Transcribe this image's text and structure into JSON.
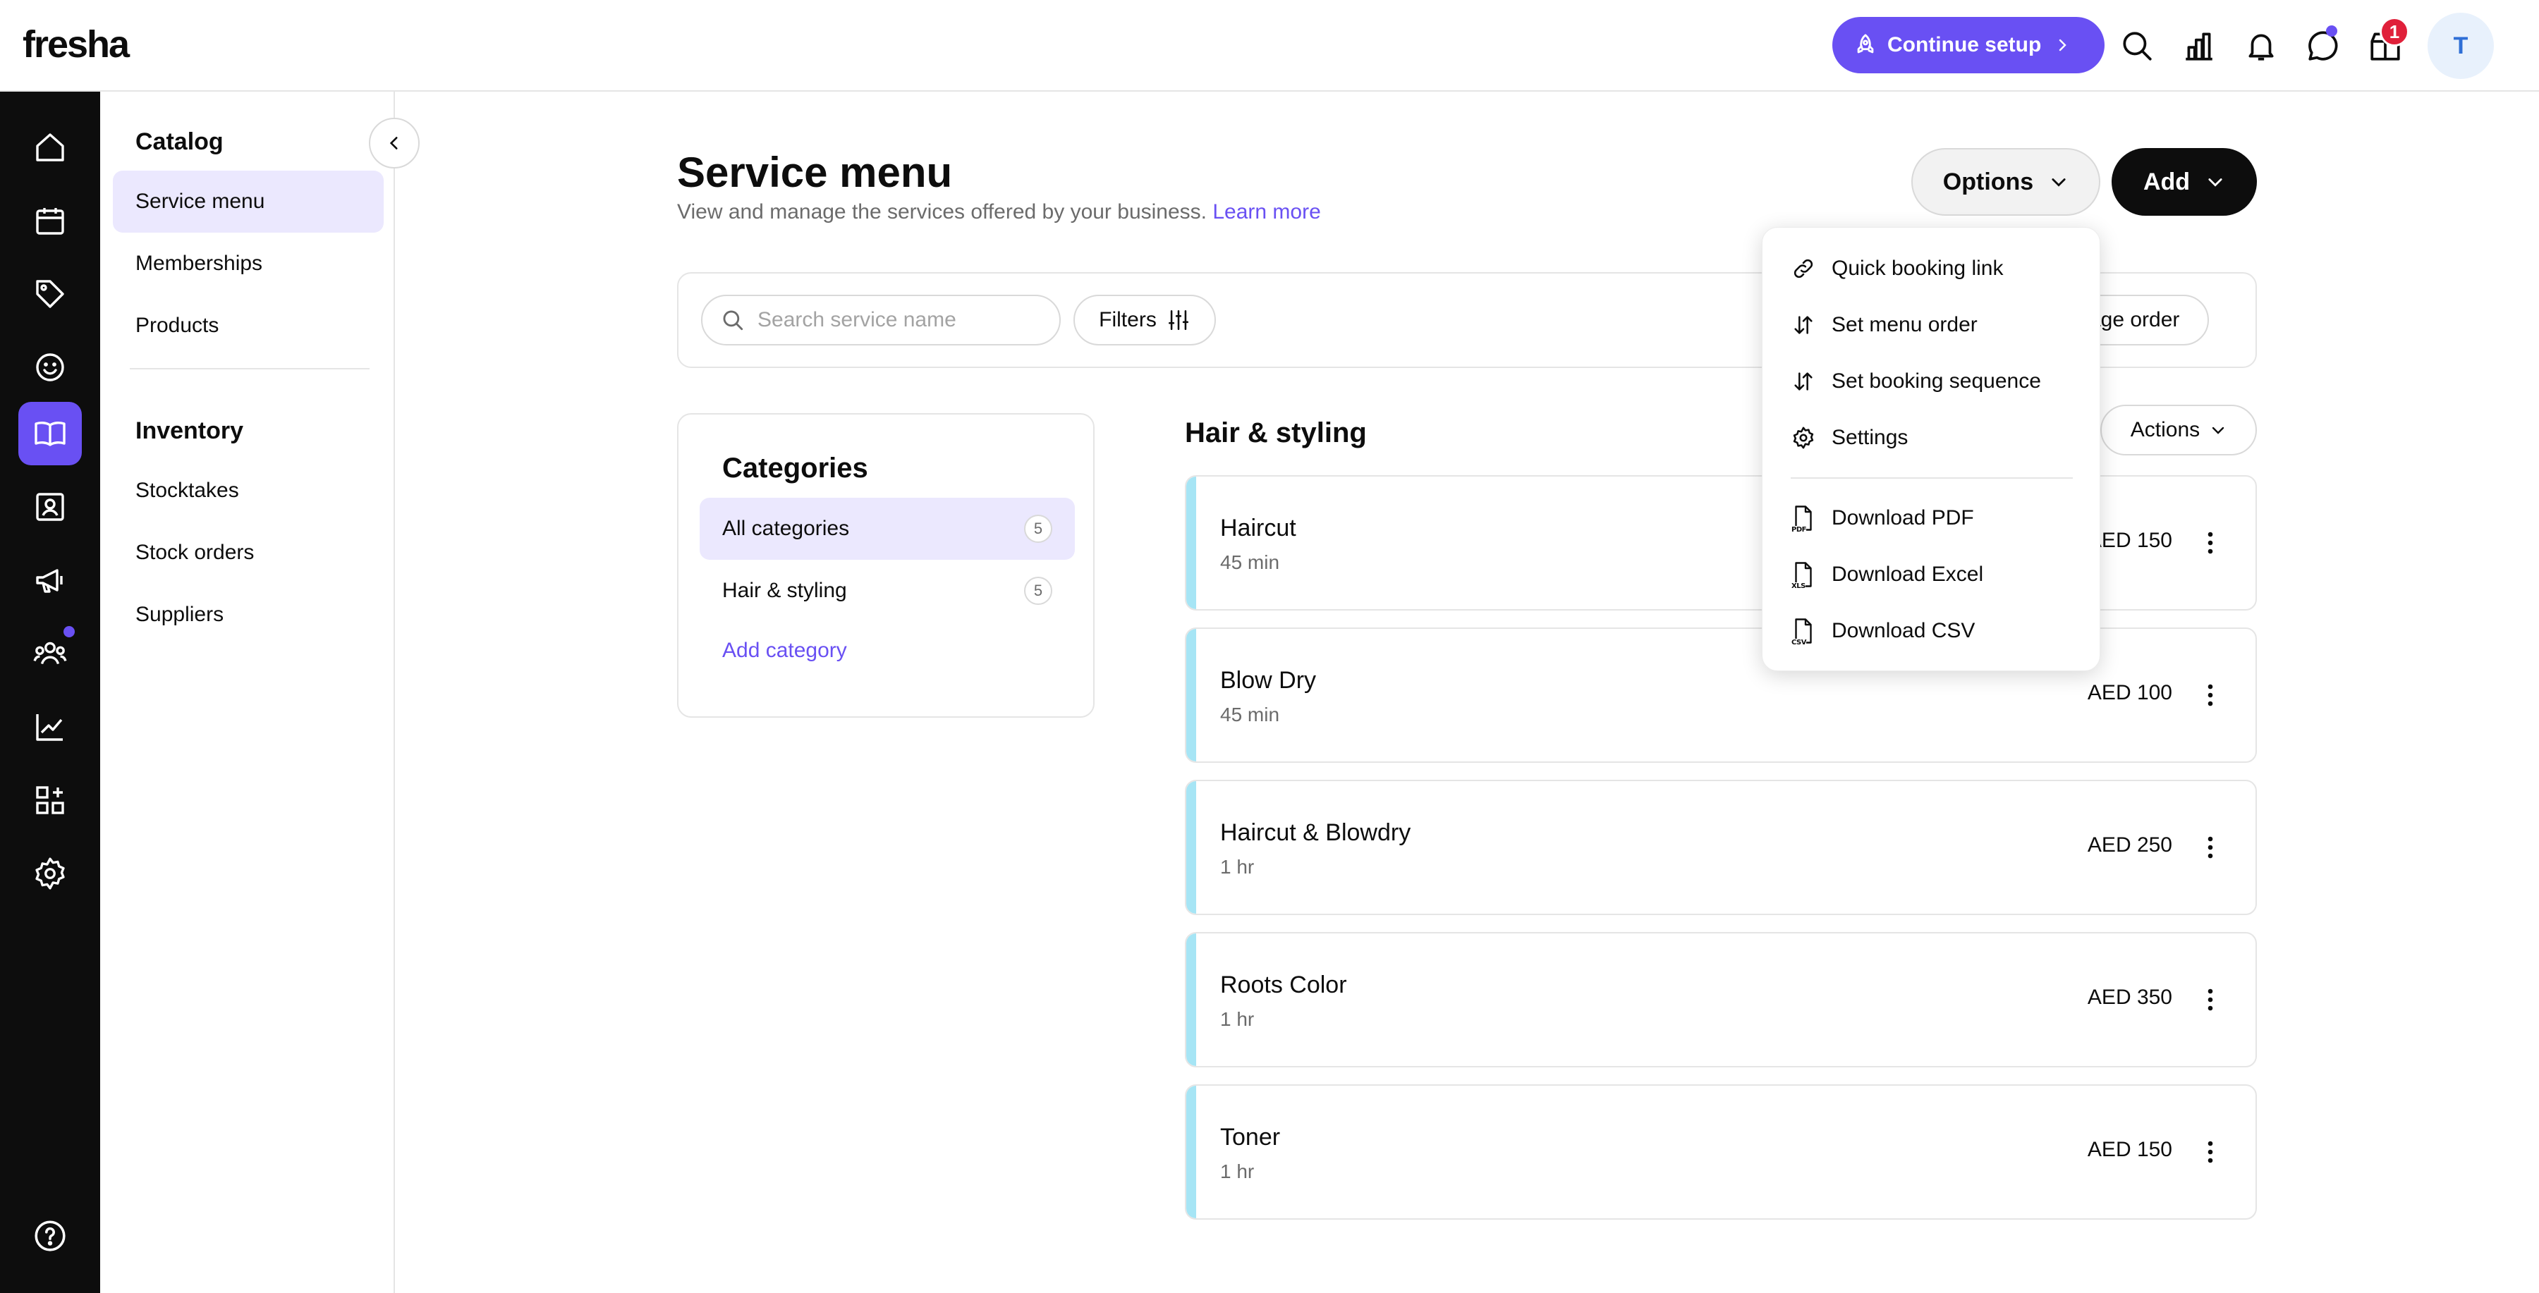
{
  "header": {
    "logo": "fresha",
    "continue_setup": "Continue setup",
    "notification_badge": "1",
    "avatar_initial": "T",
    "icons": [
      "rocket-icon",
      "search-icon",
      "chart-icon",
      "bell-icon",
      "chat-icon",
      "gift-icon"
    ]
  },
  "rail": {
    "items": [
      "home-icon",
      "calendar-icon",
      "tag-icon",
      "smiley-icon",
      "book-icon",
      "contact-card-icon",
      "megaphone-icon",
      "team-icon",
      "trend-icon",
      "apps-icon",
      "gear-icon"
    ],
    "active": "book-icon",
    "help_icon": "help-icon"
  },
  "sidebar": {
    "catalog_heading": "Catalog",
    "catalog_items": [
      "Service menu",
      "Memberships",
      "Products"
    ],
    "inventory_heading": "Inventory",
    "inventory_items": [
      "Stocktakes",
      "Stock orders",
      "Suppliers"
    ]
  },
  "main": {
    "title": "Service menu",
    "subtitle": "View and manage the services offered by your business.",
    "learn_more": "Learn more",
    "options_label": "Options",
    "add_label": "Add",
    "search_placeholder": "Search service name",
    "filters_label": "Filters",
    "manage_order_label": "Manage order",
    "categories": {
      "title": "Categories",
      "items": [
        {
          "label": "All categories",
          "count": "5"
        },
        {
          "label": "Hair & styling",
          "count": "5"
        }
      ],
      "add_category": "Add category"
    },
    "group_title": "Hair & styling",
    "actions_label": "Actions",
    "services": [
      {
        "name": "Haircut",
        "duration": "45 min",
        "price": "AED 150"
      },
      {
        "name": "Blow Dry",
        "duration": "45 min",
        "price": "AED 100"
      },
      {
        "name": "Haircut & Blowdry",
        "duration": "1 hr",
        "price": "AED 250"
      },
      {
        "name": "Roots Color",
        "duration": "1 hr",
        "price": "AED 350"
      },
      {
        "name": "Toner",
        "duration": "1 hr",
        "price": "AED 150"
      }
    ]
  },
  "options_menu": {
    "items": [
      "Quick booking link",
      "Set menu order",
      "Set booking sequence",
      "Settings"
    ],
    "downloads": [
      "Download PDF",
      "Download Excel",
      "Download CSV"
    ],
    "file_tags": [
      "PDF",
      "XLS",
      "CSV"
    ]
  },
  "colors": {
    "accent": "#6950f3",
    "accent_soft": "#ebe8fe",
    "service_bar": "#a6e5f5",
    "badge_red": "#e0203a"
  }
}
